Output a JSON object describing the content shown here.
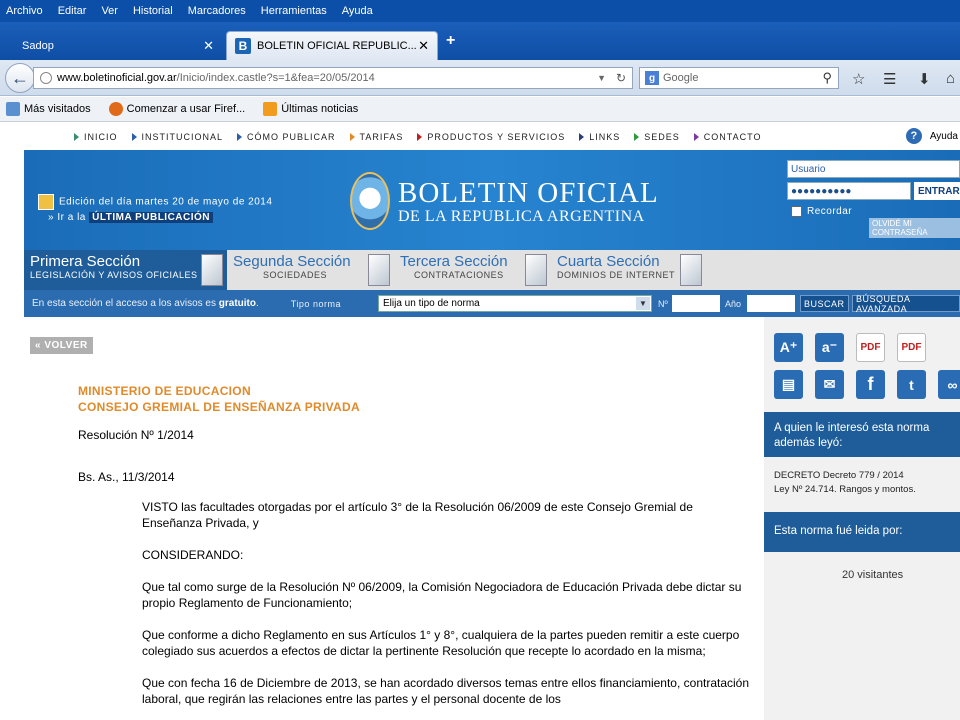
{
  "menu": [
    "Archivo",
    "Editar",
    "Ver",
    "Historial",
    "Marcadores",
    "Herramientas",
    "Ayuda"
  ],
  "tabs": [
    {
      "label": "Sadop",
      "active": false
    },
    {
      "label": "BOLETIN OFICIAL REPUBLIC...",
      "active": true
    }
  ],
  "url": {
    "prefix": "www.boletinoficial.gov.ar",
    "path": "/Inicio/index.castle?s=1&fea=20/05/2014"
  },
  "search": {
    "placeholder": "Google"
  },
  "bookmarks": [
    "Más visitados",
    "Comenzar a usar Firef...",
    "Últimas noticias"
  ],
  "topnav": [
    "INICIO",
    "INSTITUCIONAL",
    "CÓMO PUBLICAR",
    "TARIFAS",
    "PRODUCTOS Y SERVICIOS",
    "LINKS",
    "SEDES",
    "CONTACTO"
  ],
  "help": "Ayuda",
  "banner": {
    "edicion": "Edición del día martes 20 de mayo de 2014",
    "ir_a": "» Ir a la",
    "ultima": "ÚLTIMA PUBLICACIÓN",
    "logo_line1": "BOLETIN OFICIAL",
    "logo_line2": "DE LA REPUBLICA ARGENTINA"
  },
  "login": {
    "usuario_placeholder": "Usuario",
    "password_mask": "●●●●●●●●●●",
    "enter": "ENTRAR",
    "recordar": "Recordar",
    "olvide": "OLVIDÉ MI CONTRASEÑA"
  },
  "sections": [
    {
      "title": "Primera Sección",
      "sub": "LEGISLACIÓN Y AVISOS OFICIALES"
    },
    {
      "title": "Segunda Sección",
      "sub": "SOCIEDADES"
    },
    {
      "title": "Tercera Sección",
      "sub": "CONTRATACIONES"
    },
    {
      "title": "Cuarta Sección",
      "sub": "DOMINIOS DE INTERNET"
    }
  ],
  "searchrow": {
    "free_pre": "En esta sección el acceso a los avisos es",
    "free_bold": "gratuito",
    "tipo_label": "Tipo norma",
    "tipo_value": "Elija un tipo de norma",
    "n_label": "Nº",
    "anio_label": "Año",
    "buscar": "BUSCAR",
    "avanzada": "BÚSQUEDA AVANZADA"
  },
  "content": {
    "volver": "« VOLVER",
    "ministerio": "MINISTERIO DE EDUCACION",
    "consejo": "CONSEJO GREMIAL DE ENSEÑANZA PRIVADA",
    "resolucion": "Resolución Nº 1/2014",
    "fecha": "Bs. As., 11/3/2014",
    "paragraphs": [
      "VISTO las facultades otorgadas por el artículo 3° de la Resolución 06/2009 de este Consejo Gremial de Enseñanza Privada, y",
      "CONSIDERANDO:",
      "Que tal como surge de la Resolución Nº 06/2009, la Comisión Negociadora de Educación Privada debe dictar su propio Reglamento de Funcionamiento;",
      "Que conforme a dicho Reglamento en sus Artículos 1° y 8°, cualquiera de la partes pueden remitir a este cuerpo colegiado sus acuerdos a efectos de dictar la pertinente Resolución que recepte lo acordado en la misma;",
      "Que con fecha 16 de Diciembre de 2013, se han acordado diversos temas entre ellos financiamiento, contratación laboral, que regirán las relaciones entre las partes y el personal docente de los"
    ]
  },
  "sidebar": {
    "interes_title": "A quien le interesó esta norma además leyó:",
    "decreto": "DECRETO Decreto 779 / 2014",
    "ley": "Ley Nº 24.714. Rangos y montos.",
    "leida_title": "Esta norma fué leida por:",
    "visitantes": "20 visitantes"
  }
}
